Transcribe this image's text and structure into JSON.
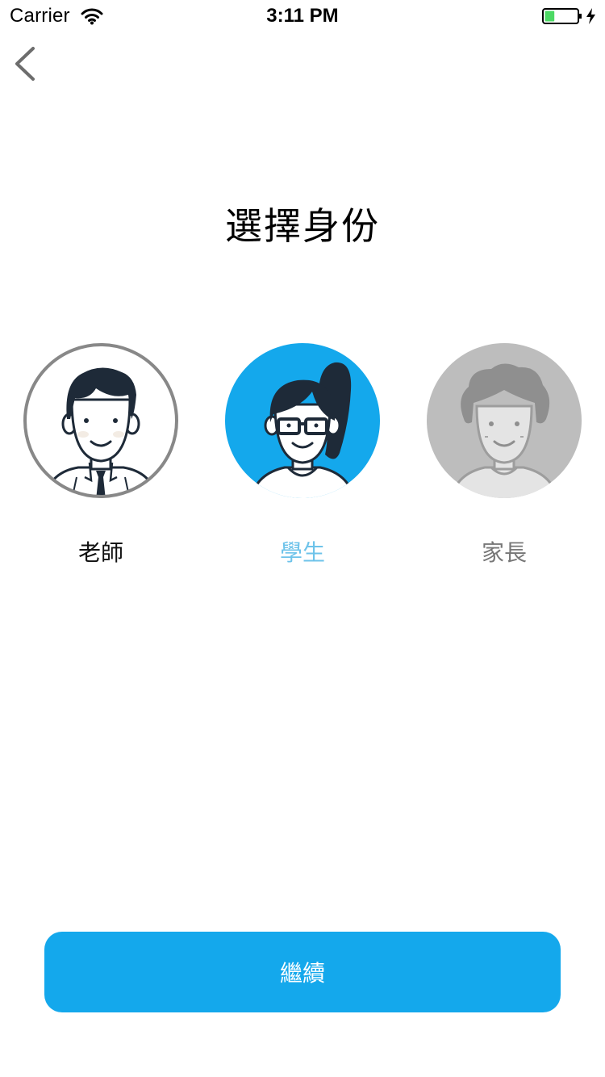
{
  "status_bar": {
    "carrier": "Carrier",
    "time": "3:11 PM",
    "battery_level": 0.3,
    "charging": true
  },
  "nav": {
    "back_icon": "chevron-left-icon"
  },
  "title": "選擇身份",
  "roles": [
    {
      "label": "老師",
      "selected": false,
      "icon": "teacher-avatar-icon",
      "label_color": "#111111"
    },
    {
      "label": "學生",
      "selected": true,
      "icon": "student-avatar-icon",
      "label_color": "#6ec3ea"
    },
    {
      "label": "家長",
      "selected": false,
      "icon": "parent-avatar-icon",
      "label_color": "#777777"
    }
  ],
  "continue_label": "繼續",
  "colors": {
    "accent": "#14a8ec",
    "dark": "#1e2a38",
    "battery": "#4cd964"
  }
}
